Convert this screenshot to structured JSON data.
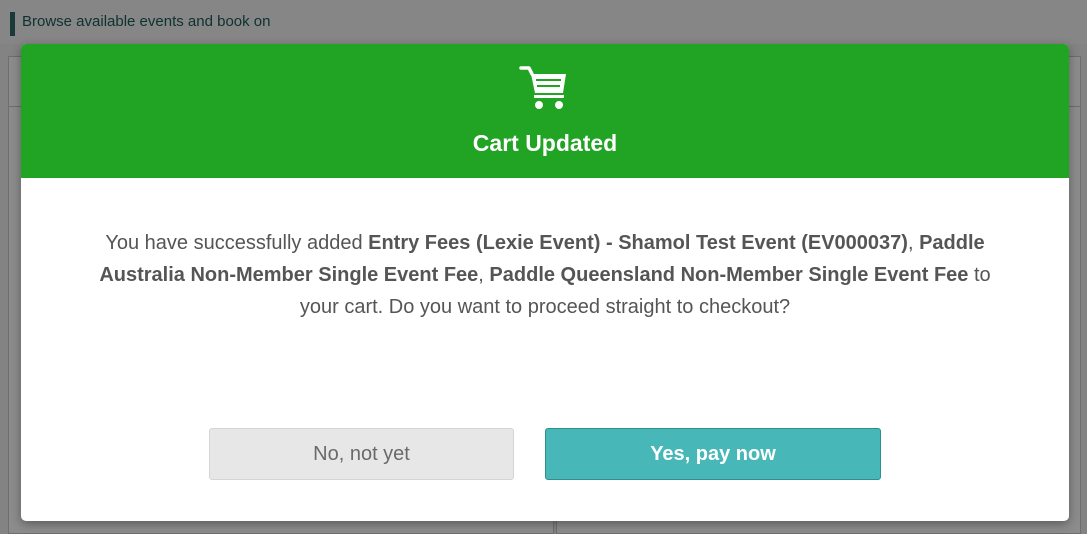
{
  "background": {
    "page_subtitle": "Browse available events and book on"
  },
  "modal": {
    "icon": "shopping-cart-icon",
    "title": "Cart Updated",
    "message": {
      "prefix": "You have successfully added ",
      "item1": "Entry Fees (Lexie Event) - Shamol Test Event (EV000037)",
      "sep1": ", ",
      "item2": "Paddle Australia Non-Member Single Event Fee",
      "sep2": ", ",
      "item3": "Paddle Queensland Non-Member Single Event Fee",
      "suffix": " to your cart. Do you want to proceed straight to checkout?"
    },
    "buttons": {
      "cancel_label": "No, not yet",
      "confirm_label": "Yes, pay now"
    }
  },
  "colors": {
    "header_green": "#21a324",
    "confirm_teal": "#47b7b7",
    "cancel_grey": "#e7e7e7",
    "text_grey": "#555555"
  }
}
